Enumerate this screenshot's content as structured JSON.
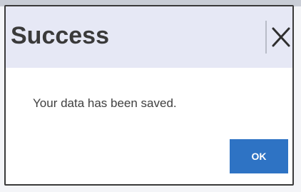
{
  "dialog": {
    "title": "Success",
    "message": "Your data has been saved.",
    "ok_label": "OK",
    "close_icon": "close-icon"
  },
  "colors": {
    "header_background": "#e6e8f5",
    "primary_button": "#2e73c4",
    "text": "#404040"
  }
}
